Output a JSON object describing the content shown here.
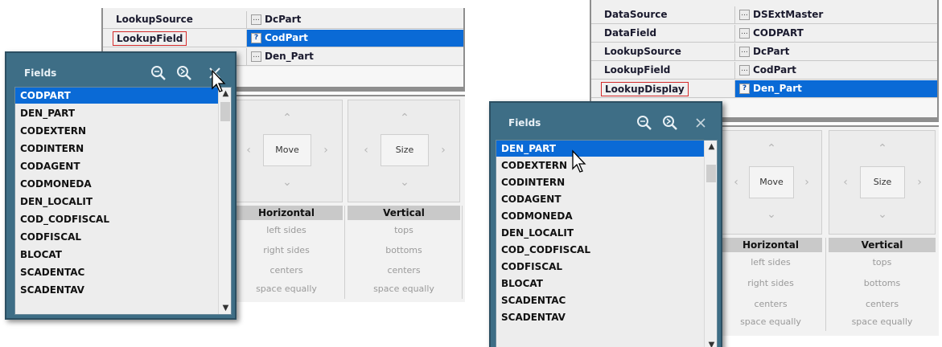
{
  "left": {
    "inspector": {
      "rows": [
        {
          "name": "LookupSource",
          "value": "DcPart",
          "btn": "..."
        },
        {
          "name": "LookupField",
          "value": "CodPart",
          "btn": "?"
        },
        {
          "name": "",
          "value": "Den_Part",
          "btn": "..."
        }
      ]
    },
    "align": {
      "move_label": "Move",
      "size_label": "Size",
      "horizontal_head": "Horizontal",
      "vertical_head": "Vertical",
      "horizontal_items": [
        "left sides",
        "right sides",
        "centers",
        "space equally"
      ],
      "vertical_items": [
        "tops",
        "bottoms",
        "centers",
        "space equally"
      ]
    },
    "fields_popup": {
      "title": "Fields",
      "items": [
        "CODPART",
        "DEN_PART",
        "CODEXTERN",
        "CODINTERN",
        "CODAGENT",
        "CODMONEDA",
        "DEN_LOCALIT",
        "COD_CODFISCAL",
        "CODFISCAL",
        "BLOCAT",
        "SCADENTAC",
        "SCADENTAV"
      ],
      "selected_index": 0
    }
  },
  "right": {
    "inspector": {
      "rows": [
        {
          "name": "DataSource",
          "value": "DSExtMaster",
          "btn": "..."
        },
        {
          "name": "DataField",
          "value": "CODPART",
          "btn": "..."
        },
        {
          "name": "LookupSource",
          "value": "DcPart",
          "btn": "..."
        },
        {
          "name": "LookupField",
          "value": "CodPart",
          "btn": "..."
        },
        {
          "name": "LookupDisplay",
          "value": "Den_Part",
          "btn": "?"
        }
      ]
    },
    "align": {
      "move_label": "Move",
      "size_label": "Size",
      "horizontal_head": "Horizontal",
      "vertical_head": "Vertical",
      "horizontal_items": [
        "left sides",
        "right sides",
        "centers",
        "space equally"
      ],
      "vertical_items": [
        "tops",
        "bottoms",
        "centers",
        "space equally"
      ]
    },
    "fields_popup": {
      "title": "Fields",
      "items": [
        "DEN_PART",
        "CODEXTERN",
        "CODINTERN",
        "CODAGENT",
        "CODMONEDA",
        "DEN_LOCALIT",
        "COD_CODFISCAL",
        "CODFISCAL",
        "BLOCAT",
        "SCADENTAC",
        "SCADENTAV"
      ],
      "selected_index": 0
    }
  },
  "icons": [
    "search-icon",
    "search-next-icon",
    "close-icon",
    "mouse-cursor-icon"
  ],
  "colors": {
    "selection": "#0a6ad6",
    "popup_header": "#3e6e86",
    "highlight_box": "#d42a2a"
  }
}
